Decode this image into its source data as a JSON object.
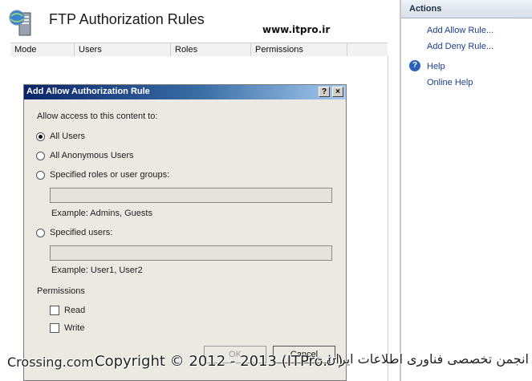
{
  "page": {
    "title": "FTP Authorization Rules",
    "watermark_url": "www.itpro.ir"
  },
  "grid": {
    "columns": [
      "Mode",
      "Users",
      "Roles",
      "Permissions"
    ]
  },
  "actions": {
    "header": "Actions",
    "add_allow": "Add Allow Rule...",
    "add_deny": "Add Deny Rule...",
    "help": "Help",
    "online_help": "Online Help"
  },
  "dialog": {
    "title": "Add Allow Authorization Rule",
    "help_button": "?",
    "close_button": "×",
    "prompt": "Allow access to this content to:",
    "options": {
      "all_users": "All Users",
      "all_anonymous": "All Anonymous Users",
      "roles_groups": "Specified roles or user groups:",
      "specified_users": "Specified users:"
    },
    "selected_option": "All Users",
    "roles_example": "Example: Admins, Guests",
    "users_example": "Example: User1, User2",
    "roles_value": "",
    "users_value": "",
    "permissions_label": "Permissions",
    "read_label": "Read",
    "write_label": "Write",
    "ok_label": "OK",
    "cancel_label": "Cancel"
  },
  "footer": {
    "left": "Crossing.com",
    "copyright": "Copyright © 2012 - 2013 (ITPro.ir)",
    "persian": "انجمن تخصصی فناوری اطلاعات ایران -"
  },
  "colors": {
    "titlebar_start": "#0a246a",
    "titlebar_end": "#a6caf0",
    "link": "#1c3f8f",
    "dialog_bg": "#ece9e2"
  }
}
